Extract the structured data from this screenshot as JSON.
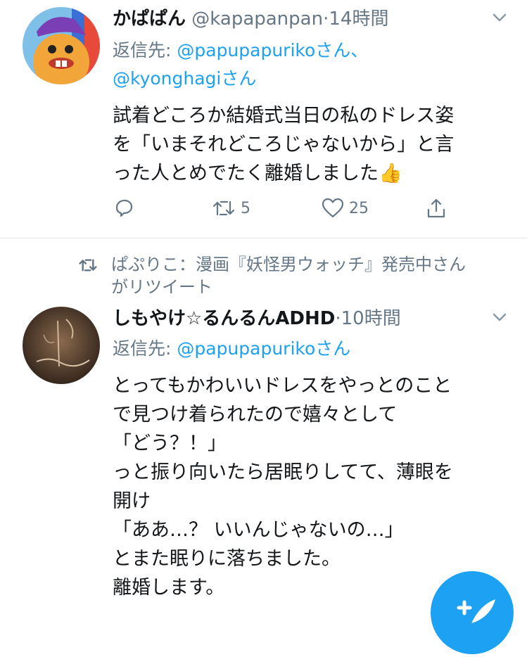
{
  "tweet1": {
    "name": "かぱぱん",
    "handle": "@kapapanpan",
    "dot": "·",
    "time": "14時間",
    "reply_prefix": "返信先: ",
    "mention1": "@papupapuriko",
    "mention1_suffix": "さん、",
    "mention2": "@kyonghagi",
    "mention2_suffix": "さん",
    "text": "試着どころか結婚式当日の私のドレス姿\nを「いまそれどころじゃないから」と言\nった人とめでたく離婚しました👍",
    "retweet_count": "5",
    "like_count": "25"
  },
  "retweet_banner": {
    "text": "ぱぷりこ：漫画『妖怪男ウォッチ』発売中さん\nがリツイート"
  },
  "tweet2": {
    "name": "しもやけ☆るんるんADHD",
    "dot": "·",
    "time": "10時間",
    "reply_prefix": "返信先: ",
    "mention1": "@papupapuriko",
    "mention1_suffix": "さん",
    "text": "とってもかわいいドレスをやっとのこと\nで見つけ着られたので嬉々として\n「どう？！」\nっと振り向いたら居眠りしてて、薄眼を\n開け\n「ああ…？ いいんじゃないの…」\nとまた眠りに落ちました。\n離婚します。"
  },
  "colors": {
    "accent": "#1da1f2",
    "secondary_text": "#657786",
    "divider": "#e1e8ed"
  },
  "icons": [
    "chevron-down-icon",
    "reply-icon",
    "retweet-icon",
    "like-icon",
    "share-icon",
    "compose-icon"
  ]
}
